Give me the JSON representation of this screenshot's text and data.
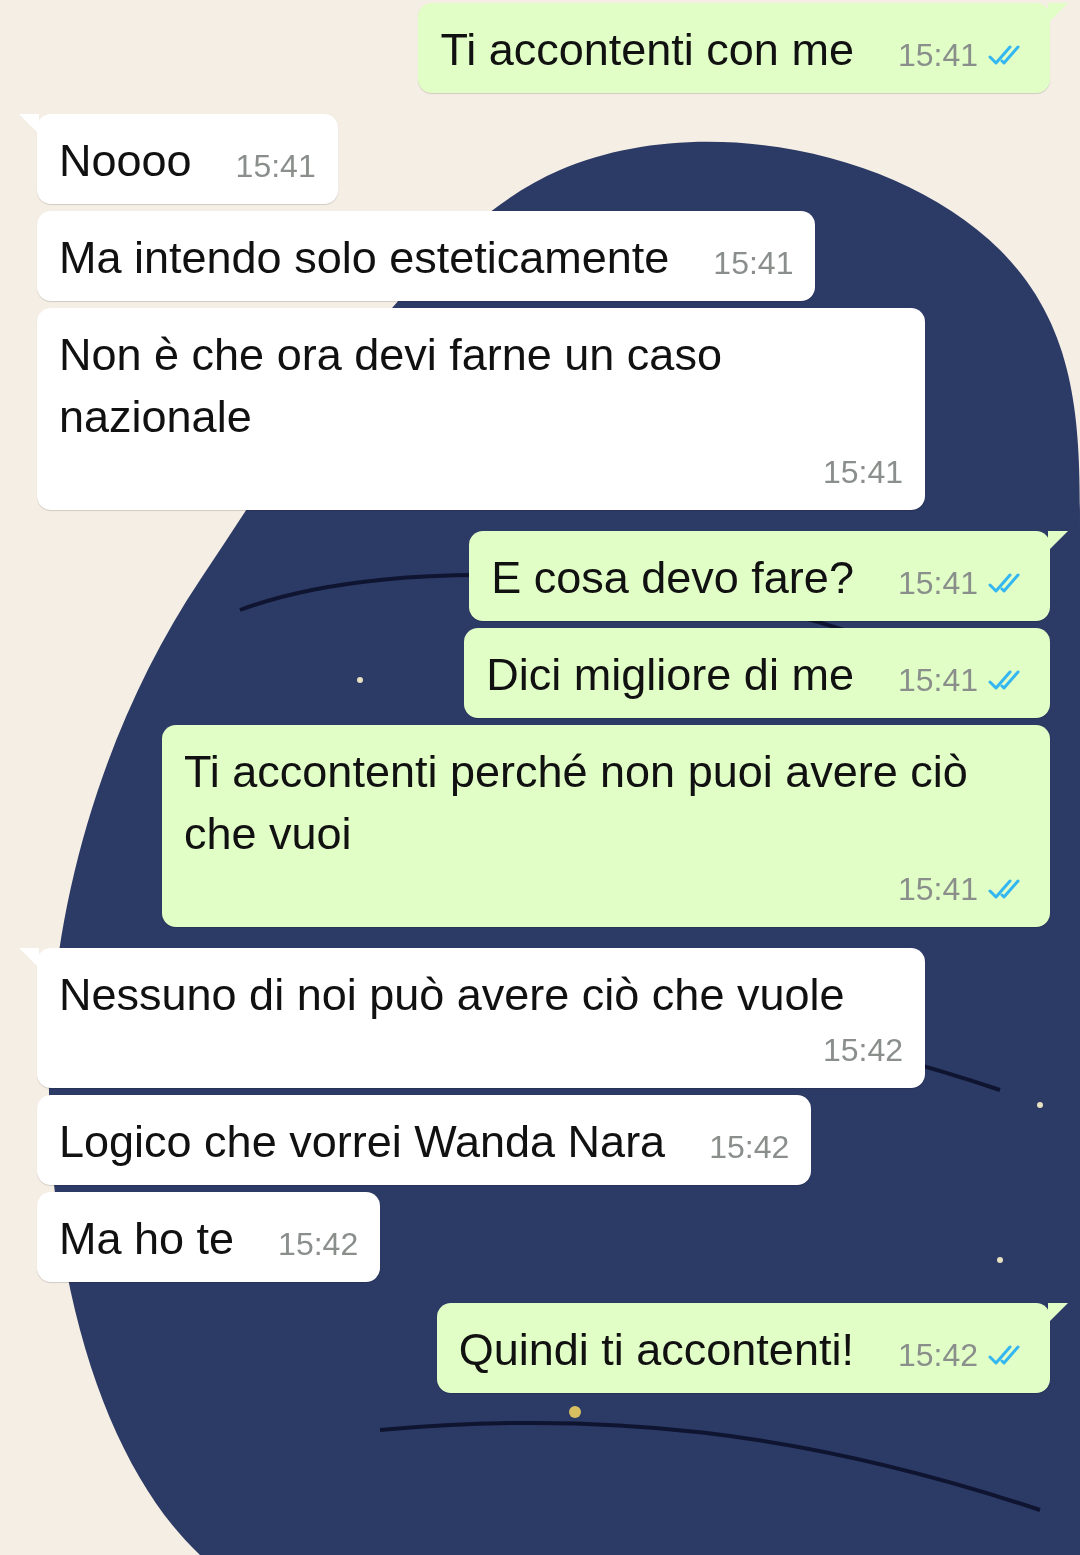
{
  "messages": [
    {
      "kind": "outgoing",
      "tail": true,
      "text": "Ti accontenti con me",
      "time": "15:41",
      "read": true
    },
    {
      "kind": "incoming",
      "tail": true,
      "text": "Noooo",
      "time": "15:41"
    },
    {
      "kind": "incoming",
      "tail": false,
      "text": "Ma intendo solo esteticamente",
      "time": "15:41"
    },
    {
      "kind": "incoming",
      "tail": false,
      "text": "Non è che ora devi farne un caso nazionale",
      "time": "15:41"
    },
    {
      "kind": "outgoing",
      "tail": true,
      "text": "E cosa devo fare?",
      "time": "15:41",
      "read": true
    },
    {
      "kind": "outgoing",
      "tail": false,
      "text": "Dici migliore di me",
      "time": "15:41",
      "read": true
    },
    {
      "kind": "outgoing",
      "tail": false,
      "text": "Ti accontenti perché non puoi avere ciò che vuoi",
      "time": "15:41",
      "read": true
    },
    {
      "kind": "incoming",
      "tail": true,
      "text": "Nessuno di noi può avere ciò che vuole",
      "time": "15:42"
    },
    {
      "kind": "incoming",
      "tail": false,
      "text": "Logico che vorrei Wanda Nara",
      "time": "15:42"
    },
    {
      "kind": "incoming",
      "tail": false,
      "text": "Ma ho te",
      "time": "15:42"
    },
    {
      "kind": "outgoing",
      "tail": true,
      "text": "Quindi ti accontenti!",
      "time": "15:42",
      "read": true
    }
  ]
}
